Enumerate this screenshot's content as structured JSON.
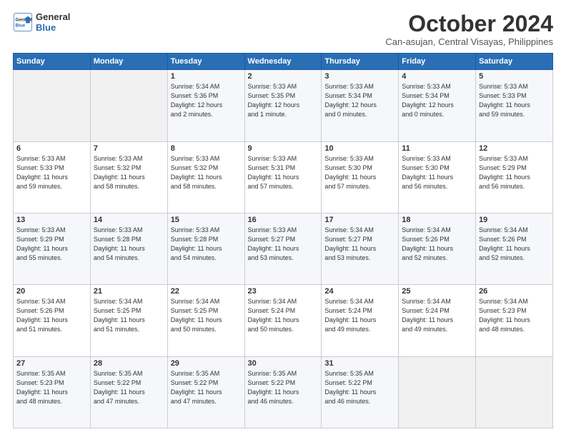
{
  "logo": {
    "line1": "General",
    "line2": "Blue"
  },
  "title": "October 2024",
  "location": "Can-asujan, Central Visayas, Philippines",
  "days_of_week": [
    "Sunday",
    "Monday",
    "Tuesday",
    "Wednesday",
    "Thursday",
    "Friday",
    "Saturday"
  ],
  "weeks": [
    [
      {
        "day": "",
        "data": ""
      },
      {
        "day": "",
        "data": ""
      },
      {
        "day": "1",
        "data": "Sunrise: 5:34 AM\nSunset: 5:36 PM\nDaylight: 12 hours\nand 2 minutes."
      },
      {
        "day": "2",
        "data": "Sunrise: 5:33 AM\nSunset: 5:35 PM\nDaylight: 12 hours\nand 1 minute."
      },
      {
        "day": "3",
        "data": "Sunrise: 5:33 AM\nSunset: 5:34 PM\nDaylight: 12 hours\nand 0 minutes."
      },
      {
        "day": "4",
        "data": "Sunrise: 5:33 AM\nSunset: 5:34 PM\nDaylight: 12 hours\nand 0 minutes."
      },
      {
        "day": "5",
        "data": "Sunrise: 5:33 AM\nSunset: 5:33 PM\nDaylight: 11 hours\nand 59 minutes."
      }
    ],
    [
      {
        "day": "6",
        "data": "Sunrise: 5:33 AM\nSunset: 5:33 PM\nDaylight: 11 hours\nand 59 minutes."
      },
      {
        "day": "7",
        "data": "Sunrise: 5:33 AM\nSunset: 5:32 PM\nDaylight: 11 hours\nand 58 minutes."
      },
      {
        "day": "8",
        "data": "Sunrise: 5:33 AM\nSunset: 5:32 PM\nDaylight: 11 hours\nand 58 minutes."
      },
      {
        "day": "9",
        "data": "Sunrise: 5:33 AM\nSunset: 5:31 PM\nDaylight: 11 hours\nand 57 minutes."
      },
      {
        "day": "10",
        "data": "Sunrise: 5:33 AM\nSunset: 5:30 PM\nDaylight: 11 hours\nand 57 minutes."
      },
      {
        "day": "11",
        "data": "Sunrise: 5:33 AM\nSunset: 5:30 PM\nDaylight: 11 hours\nand 56 minutes."
      },
      {
        "day": "12",
        "data": "Sunrise: 5:33 AM\nSunset: 5:29 PM\nDaylight: 11 hours\nand 56 minutes."
      }
    ],
    [
      {
        "day": "13",
        "data": "Sunrise: 5:33 AM\nSunset: 5:29 PM\nDaylight: 11 hours\nand 55 minutes."
      },
      {
        "day": "14",
        "data": "Sunrise: 5:33 AM\nSunset: 5:28 PM\nDaylight: 11 hours\nand 54 minutes."
      },
      {
        "day": "15",
        "data": "Sunrise: 5:33 AM\nSunset: 5:28 PM\nDaylight: 11 hours\nand 54 minutes."
      },
      {
        "day": "16",
        "data": "Sunrise: 5:33 AM\nSunset: 5:27 PM\nDaylight: 11 hours\nand 53 minutes."
      },
      {
        "day": "17",
        "data": "Sunrise: 5:34 AM\nSunset: 5:27 PM\nDaylight: 11 hours\nand 53 minutes."
      },
      {
        "day": "18",
        "data": "Sunrise: 5:34 AM\nSunset: 5:26 PM\nDaylight: 11 hours\nand 52 minutes."
      },
      {
        "day": "19",
        "data": "Sunrise: 5:34 AM\nSunset: 5:26 PM\nDaylight: 11 hours\nand 52 minutes."
      }
    ],
    [
      {
        "day": "20",
        "data": "Sunrise: 5:34 AM\nSunset: 5:26 PM\nDaylight: 11 hours\nand 51 minutes."
      },
      {
        "day": "21",
        "data": "Sunrise: 5:34 AM\nSunset: 5:25 PM\nDaylight: 11 hours\nand 51 minutes."
      },
      {
        "day": "22",
        "data": "Sunrise: 5:34 AM\nSunset: 5:25 PM\nDaylight: 11 hours\nand 50 minutes."
      },
      {
        "day": "23",
        "data": "Sunrise: 5:34 AM\nSunset: 5:24 PM\nDaylight: 11 hours\nand 50 minutes."
      },
      {
        "day": "24",
        "data": "Sunrise: 5:34 AM\nSunset: 5:24 PM\nDaylight: 11 hours\nand 49 minutes."
      },
      {
        "day": "25",
        "data": "Sunrise: 5:34 AM\nSunset: 5:24 PM\nDaylight: 11 hours\nand 49 minutes."
      },
      {
        "day": "26",
        "data": "Sunrise: 5:34 AM\nSunset: 5:23 PM\nDaylight: 11 hours\nand 48 minutes."
      }
    ],
    [
      {
        "day": "27",
        "data": "Sunrise: 5:35 AM\nSunset: 5:23 PM\nDaylight: 11 hours\nand 48 minutes."
      },
      {
        "day": "28",
        "data": "Sunrise: 5:35 AM\nSunset: 5:22 PM\nDaylight: 11 hours\nand 47 minutes."
      },
      {
        "day": "29",
        "data": "Sunrise: 5:35 AM\nSunset: 5:22 PM\nDaylight: 11 hours\nand 47 minutes."
      },
      {
        "day": "30",
        "data": "Sunrise: 5:35 AM\nSunset: 5:22 PM\nDaylight: 11 hours\nand 46 minutes."
      },
      {
        "day": "31",
        "data": "Sunrise: 5:35 AM\nSunset: 5:22 PM\nDaylight: 11 hours\nand 46 minutes."
      },
      {
        "day": "",
        "data": ""
      },
      {
        "day": "",
        "data": ""
      }
    ]
  ]
}
